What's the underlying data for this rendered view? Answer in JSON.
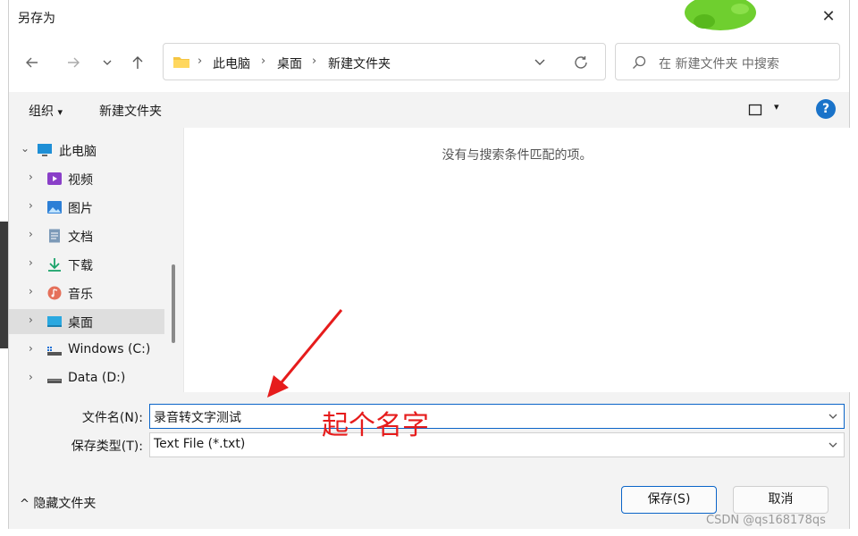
{
  "window": {
    "title": "另存为",
    "close_glyph": "✕"
  },
  "nav": {
    "back_icon": "arrow-left-icon",
    "forward_icon": "arrow-right-icon",
    "recent_icon": "chevron-down-icon",
    "up_icon": "arrow-up-icon",
    "breadcrumb": [
      "此电脑",
      "桌面",
      "新建文件夹"
    ],
    "refresh_icon": "refresh-icon",
    "search_placeholder": "在 新建文件夹 中搜索"
  },
  "toolbar": {
    "organize_label": "组织",
    "organize_arrow": "▾",
    "new_folder_label": "新建文件夹",
    "view_arrow": "▾",
    "help_glyph": "?"
  },
  "tree": [
    {
      "label": "此电脑",
      "icon": "computer-icon",
      "expanded": true
    },
    {
      "label": "视频",
      "icon": "video-icon"
    },
    {
      "label": "图片",
      "icon": "picture-icon"
    },
    {
      "label": "文档",
      "icon": "document-icon"
    },
    {
      "label": "下载",
      "icon": "download-icon"
    },
    {
      "label": "音乐",
      "icon": "music-icon"
    },
    {
      "label": "桌面",
      "icon": "desktop-icon",
      "selected": true
    },
    {
      "label": "Windows (C:)",
      "icon": "drive-icon"
    },
    {
      "label": "Data (D:)",
      "icon": "drive-icon"
    }
  ],
  "content": {
    "empty_message": "没有与搜索条件匹配的项。"
  },
  "form": {
    "filename_label": "文件名(N):",
    "filename_value": "录音转文字测试",
    "filetype_label": "保存类型(T):",
    "filetype_value": "Text File (*.txt)"
  },
  "annotation": {
    "text": "起个名字",
    "color": "#e61c1c"
  },
  "footer": {
    "hide_folders_label": "隐藏文件夹",
    "hide_folders_glyph": "^",
    "save_label": "保存(S)",
    "cancel_label": "取消"
  },
  "watermark": "CSDN @qs168178qs",
  "colors": {
    "accent": "#0a64c8",
    "help": "#1a73c9",
    "pane_bg": "#f3f3f3"
  }
}
